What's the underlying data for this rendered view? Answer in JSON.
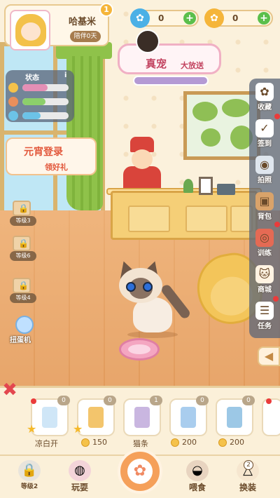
{
  "player": {
    "name": "哈基米",
    "days": "陪伴0天",
    "level": "1"
  },
  "currency": [
    {
      "icon": "paw-blue-icon",
      "value": "0",
      "color": "#4bb0e6"
    },
    {
      "icon": "paw-gold-icon",
      "value": "0",
      "color": "#f5b53a"
    }
  ],
  "event": {
    "title": "真宠",
    "subtitle": "大放送"
  },
  "status": {
    "title": "状态",
    "info": "i",
    "bars": [
      {
        "icon": "mood-icon",
        "level": 0.55,
        "color": "#e48fb5"
      },
      {
        "icon": "food-icon",
        "level": 0.5,
        "color": "#8ccf6b"
      },
      {
        "icon": "water-icon",
        "level": 0.4,
        "color": "#6cc3e8"
      }
    ]
  },
  "promo": {
    "title": "元宵登录",
    "subtitle": "领好礼"
  },
  "locked": [
    {
      "label": "等级3"
    },
    {
      "label": "等级6"
    },
    {
      "label": "等级4"
    }
  ],
  "gacha": {
    "label": "扭蛋机"
  },
  "right_menu": [
    {
      "label": "收藏",
      "icon": "collection-icon"
    },
    {
      "label": "签到",
      "icon": "calendar-icon"
    },
    {
      "label": "拍照",
      "icon": "camera-icon"
    },
    {
      "label": "背包",
      "icon": "backpack-icon"
    },
    {
      "label": "训练",
      "icon": "training-icon"
    },
    {
      "label": "商城",
      "icon": "shop-icon"
    },
    {
      "label": "任务",
      "icon": "task-icon"
    }
  ],
  "tray": {
    "items": [
      {
        "count": "0",
        "label": "凉白开",
        "price": ""
      },
      {
        "count": "0",
        "label": "",
        "price": "150"
      },
      {
        "count": "1",
        "label": "猫条",
        "price": ""
      },
      {
        "count": "0",
        "label": "",
        "price": "200"
      },
      {
        "count": "0",
        "label": "",
        "price": "200"
      }
    ]
  },
  "nav": [
    {
      "label": "等级2",
      "icon": "locked-icon"
    },
    {
      "label": "玩耍",
      "icon": "yarn-icon"
    },
    {
      "label": "",
      "icon": "paw-icon"
    },
    {
      "label": "喂食",
      "icon": "bowl-icon"
    },
    {
      "label": "换装",
      "icon": "hanger-icon"
    }
  ],
  "nav_badges": {
    "feed": "",
    "dress": "2"
  }
}
